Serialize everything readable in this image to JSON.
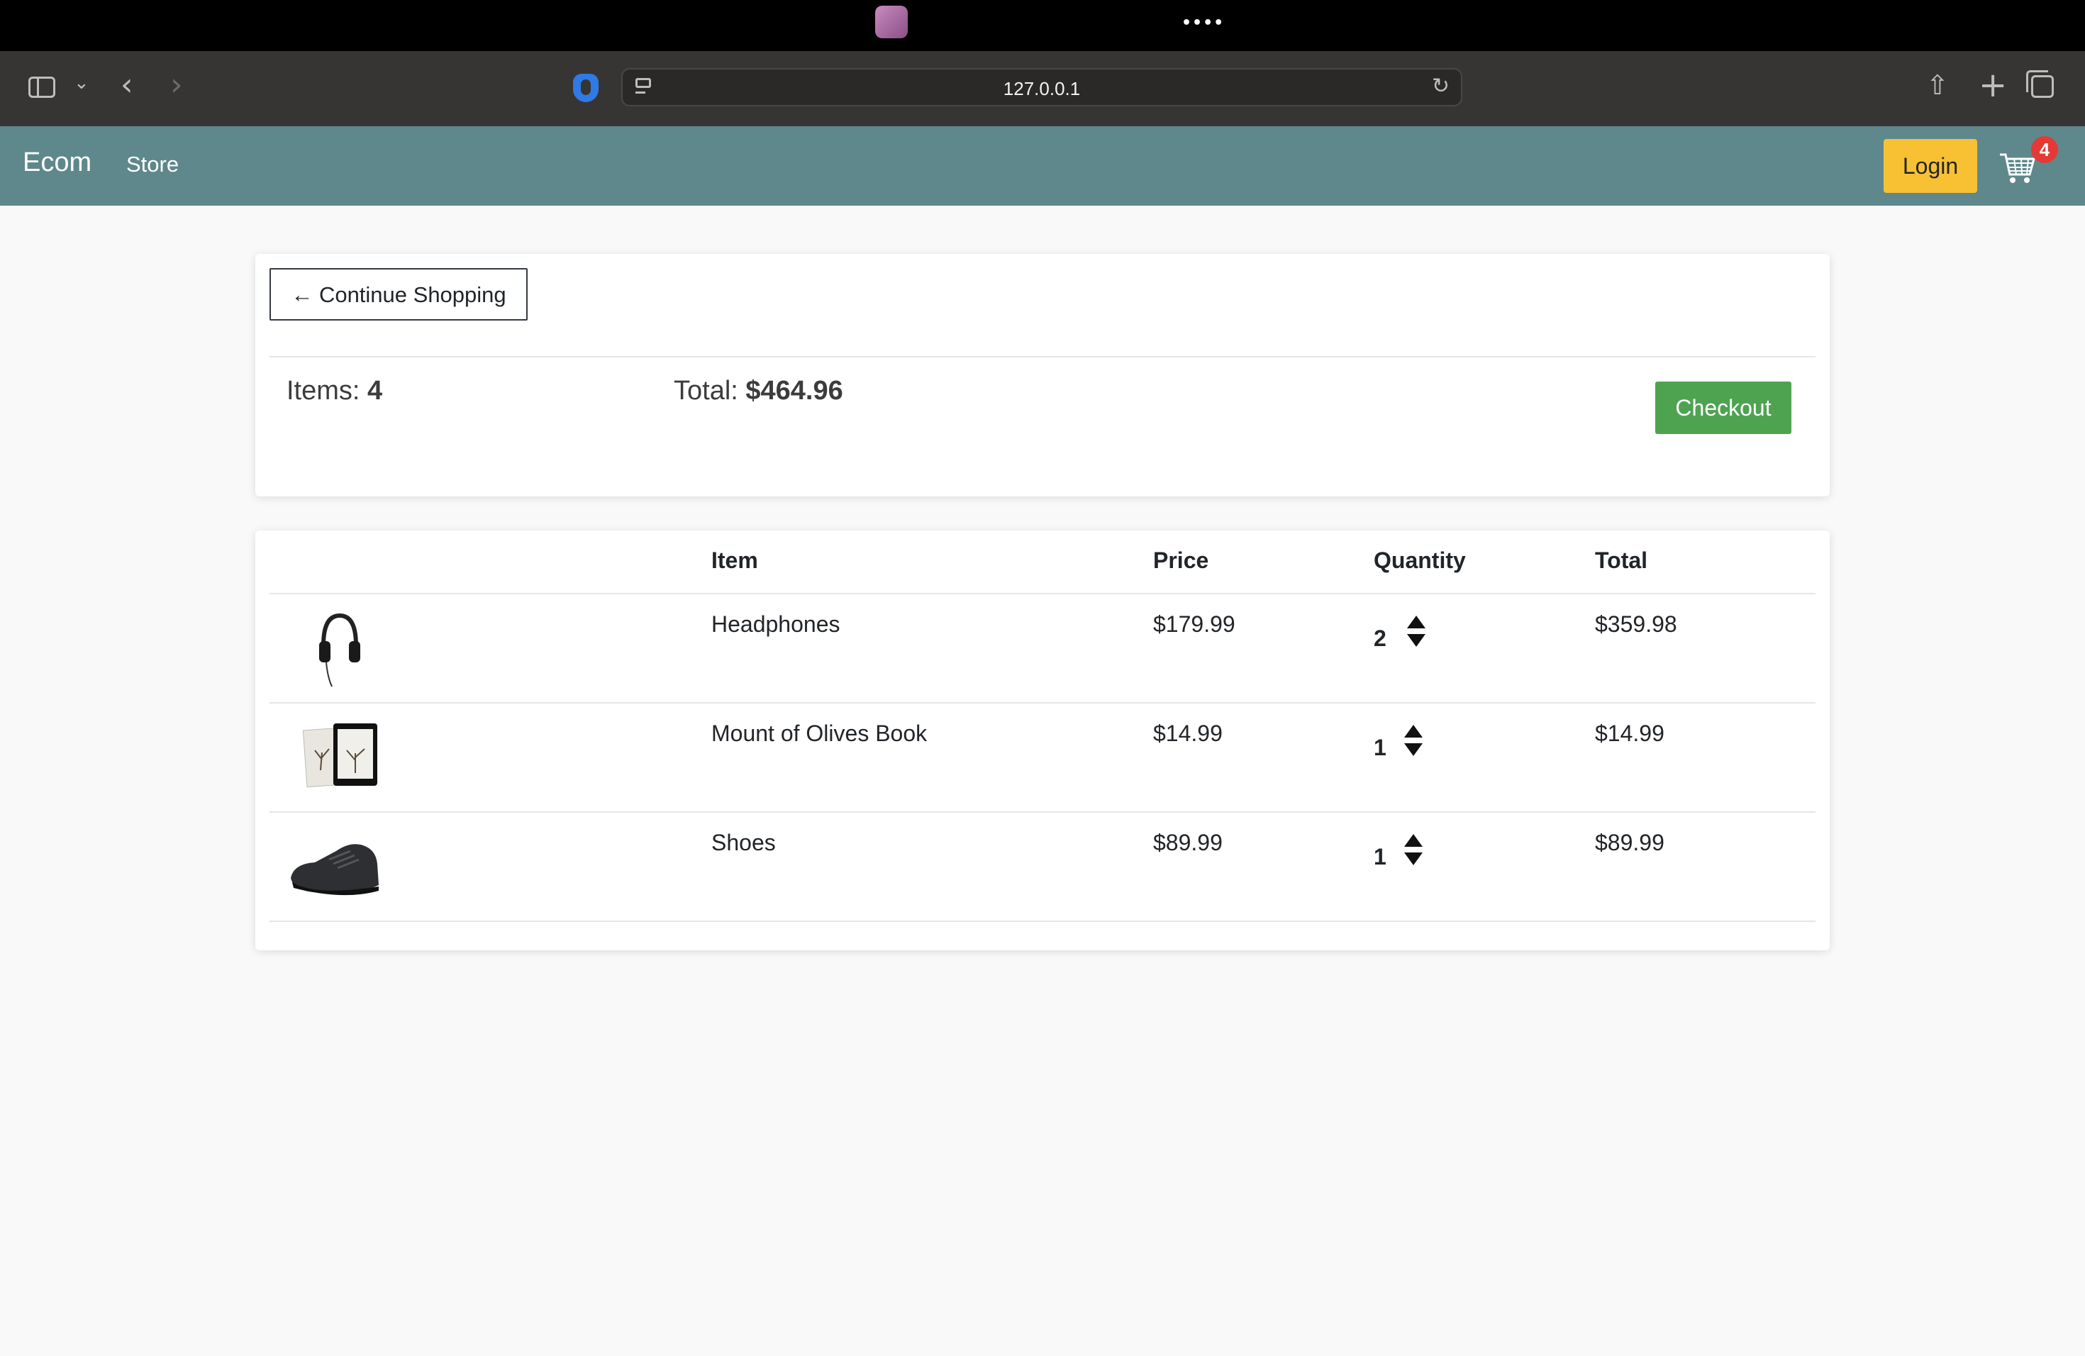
{
  "browser": {
    "url": "127.0.0.1"
  },
  "navbar": {
    "brand": "Ecom",
    "store_link": "Store",
    "login_label": "Login",
    "cart_count": "4"
  },
  "summary": {
    "continue_label": "← Continue Shopping",
    "items_prefix": "Items: ",
    "items_value": "4",
    "total_prefix": "Total: ",
    "total_value": "$464.96",
    "checkout_label": "Checkout"
  },
  "table": {
    "headers": [
      "Item",
      "Price",
      "Quantity",
      "Total"
    ],
    "rows": [
      {
        "name": "Headphones",
        "price": "$179.99",
        "quantity": "2",
        "total": "$359.98",
        "image": "headphones"
      },
      {
        "name": "Mount of Olives Book",
        "price": "$14.99",
        "quantity": "1",
        "total": "$14.99",
        "image": "book"
      },
      {
        "name": "Shoes",
        "price": "$89.99",
        "quantity": "1",
        "total": "$89.99",
        "image": "shoes"
      }
    ]
  },
  "colors": {
    "navbar": "#5f888c",
    "login": "#f8c133",
    "checkout": "#4ea351",
    "badge": "#e53935"
  }
}
